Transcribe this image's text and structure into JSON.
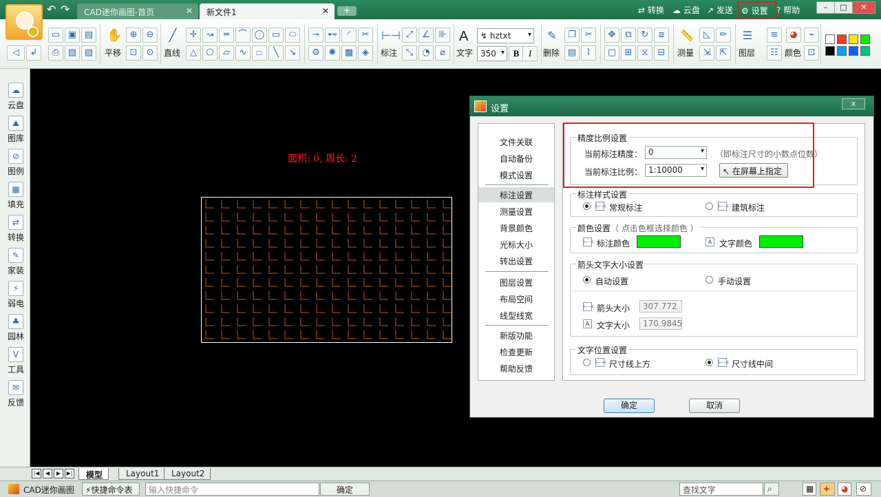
{
  "titlebar": {
    "tabs": [
      {
        "label": "CAD迷你画图-首页",
        "close": "✕"
      },
      {
        "label": "新文件1",
        "close": "✕"
      }
    ],
    "add_tab": "+",
    "links": [
      {
        "label": "转换",
        "icon": "convert-icon"
      },
      {
        "label": "云盘",
        "icon": "cloud-icon"
      },
      {
        "label": "发送",
        "icon": "send-icon"
      },
      {
        "label": "设置",
        "icon": "gear-icon"
      },
      {
        "label": "帮助",
        "icon": "help-icon"
      }
    ],
    "window_controls": [
      "–",
      "□",
      "✕"
    ]
  },
  "toolbar": {
    "labels": {
      "pan": "平移",
      "line": "直线",
      "dimension": "标注",
      "text": "文字",
      "delete": "删除",
      "measure": "测量",
      "layer": "图层",
      "color": "颜色"
    },
    "font_combo": "hztxt",
    "size_combo": "350",
    "bold": "B",
    "italic": "I",
    "text_glyph": "A",
    "palette": [
      "#ffffff",
      "#ff3b1f",
      "#ffe800",
      "#00ee00",
      "#000000",
      "#00a0ff",
      "#1060ff",
      "#00c080"
    ]
  },
  "sidebar": {
    "items": [
      "云盘",
      "图库",
      "图例",
      "填充",
      "转换",
      "家装",
      "弱电",
      "园林",
      "工具",
      "反馈"
    ]
  },
  "canvas": {
    "area_label": "面积: 0, 周长: 2"
  },
  "layout_tabs": [
    "模型",
    "Layout1",
    "Layout2"
  ],
  "statusbar": {
    "app_name": "CAD迷你画图",
    "shortcut_btn": "快捷命令表",
    "command_placeholder": "输入快捷命令",
    "confirm": "确定",
    "search_placeholder": "查找文字"
  },
  "dialog": {
    "title": "设置",
    "close": "x",
    "nav": [
      "文件关联",
      "自动备份",
      "模式设置",
      "标注设置",
      "测量设置",
      "背景颜色",
      "光标大小",
      "转出设置",
      "图层设置",
      "布局空间",
      "线型线宽",
      "新版功能",
      "检查更新",
      "帮助反馈"
    ],
    "selected_nav": "标注设置",
    "precision_group": {
      "title": "精度比例设置",
      "precision_label": "当前标注精度：",
      "precision_value": "0",
      "precision_hint": "（即标注尺寸的小数点位数）",
      "scale_label": "当前标注比例：",
      "scale_value": "1:10000",
      "pick_button": "在屏幕上指定"
    },
    "style_group": {
      "title": "标注样式设置",
      "option_normal": "常规标注",
      "option_arch": "建筑标注",
      "selected": "常规标注"
    },
    "color_group": {
      "title": "颜色设置",
      "hint": "（ 点击色框选择颜色 ）",
      "dim_color_label": "标注颜色",
      "text_color_label": "文字颜色",
      "dim_color": "#00ee00",
      "text_color": "#00ee00"
    },
    "arrow_group": {
      "title": "箭头文字大小设置",
      "option_auto": "自动设置",
      "option_manual": "手动设置",
      "selected": "自动设置",
      "arrow_size_label": "箭头大小",
      "arrow_size_value": "307.772",
      "text_size_label": "文字大小",
      "text_size_value": "170.9845"
    },
    "text_pos_group": {
      "title": "文字位置设置",
      "option_above": "尺寸线上方",
      "option_middle": "尺寸线中间",
      "selected": "尺寸线中间"
    },
    "ok": "确定",
    "cancel": "取消"
  }
}
